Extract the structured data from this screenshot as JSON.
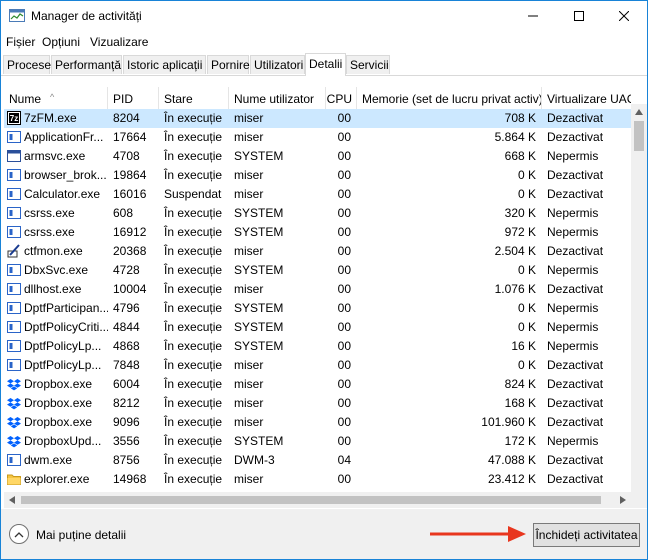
{
  "window": {
    "title": "Manager de activități"
  },
  "menu": [
    "Fișier",
    "Opțiuni",
    "Vizualizare"
  ],
  "tabs": [
    {
      "label": "Procese",
      "active": false
    },
    {
      "label": "Performanță",
      "active": false
    },
    {
      "label": "Istoric aplicații",
      "active": false
    },
    {
      "label": "Pornire",
      "active": false
    },
    {
      "label": "Utilizatori",
      "active": false
    },
    {
      "label": "Detalii",
      "active": true
    },
    {
      "label": "Servicii",
      "active": false
    }
  ],
  "table": {
    "columns": [
      "Nume",
      "PID",
      "Stare",
      "Nume utilizator",
      "CPU",
      "Memorie (set de lucru privat activ)",
      "Virtualizare UAC"
    ],
    "sort_column": "Nume",
    "rows": [
      {
        "icon": "7zfm-icon",
        "name": "7zFM.exe",
        "pid": "8204",
        "status": "În execuție",
        "user": "miser",
        "cpu": "00",
        "memory": "708 K",
        "uac": "Dezactivat",
        "selected": true
      },
      {
        "icon": "app-window-icon",
        "name": "ApplicationFr...",
        "pid": "17664",
        "status": "În execuție",
        "user": "miser",
        "cpu": "00",
        "memory": "5.864 K",
        "uac": "Dezactivat"
      },
      {
        "icon": "window-icon",
        "name": "armsvc.exe",
        "pid": "4708",
        "status": "În execuție",
        "user": "SYSTEM",
        "cpu": "00",
        "memory": "668 K",
        "uac": "Nepermis"
      },
      {
        "icon": "app-window-icon",
        "name": "browser_brok...",
        "pid": "19864",
        "status": "În execuție",
        "user": "miser",
        "cpu": "00",
        "memory": "0 K",
        "uac": "Dezactivat"
      },
      {
        "icon": "app-window-icon",
        "name": "Calculator.exe",
        "pid": "16016",
        "status": "Suspendat",
        "user": "miser",
        "cpu": "00",
        "memory": "0 K",
        "uac": "Dezactivat"
      },
      {
        "icon": "app-window-icon",
        "name": "csrss.exe",
        "pid": "608",
        "status": "În execuție",
        "user": "SYSTEM",
        "cpu": "00",
        "memory": "320 K",
        "uac": "Nepermis"
      },
      {
        "icon": "app-window-icon",
        "name": "csrss.exe",
        "pid": "16912",
        "status": "În execuție",
        "user": "SYSTEM",
        "cpu": "00",
        "memory": "972 K",
        "uac": "Nepermis"
      },
      {
        "icon": "ctfmon-icon",
        "name": "ctfmon.exe",
        "pid": "20368",
        "status": "În execuție",
        "user": "miser",
        "cpu": "00",
        "memory": "2.504 K",
        "uac": "Dezactivat"
      },
      {
        "icon": "app-window-icon",
        "name": "DbxSvc.exe",
        "pid": "4728",
        "status": "În execuție",
        "user": "SYSTEM",
        "cpu": "00",
        "memory": "0 K",
        "uac": "Nepermis"
      },
      {
        "icon": "app-window-icon",
        "name": "dllhost.exe",
        "pid": "10004",
        "status": "În execuție",
        "user": "miser",
        "cpu": "00",
        "memory": "1.076 K",
        "uac": "Dezactivat"
      },
      {
        "icon": "app-window-icon",
        "name": "DptfParticipan...",
        "pid": "4796",
        "status": "În execuție",
        "user": "SYSTEM",
        "cpu": "00",
        "memory": "0 K",
        "uac": "Nepermis"
      },
      {
        "icon": "app-window-icon",
        "name": "DptfPolicyCriti...",
        "pid": "4844",
        "status": "În execuție",
        "user": "SYSTEM",
        "cpu": "00",
        "memory": "0 K",
        "uac": "Nepermis"
      },
      {
        "icon": "app-window-icon",
        "name": "DptfPolicyLp...",
        "pid": "4868",
        "status": "În execuție",
        "user": "SYSTEM",
        "cpu": "00",
        "memory": "16 K",
        "uac": "Nepermis"
      },
      {
        "icon": "app-window-icon",
        "name": "DptfPolicyLp...",
        "pid": "7848",
        "status": "În execuție",
        "user": "miser",
        "cpu": "00",
        "memory": "0 K",
        "uac": "Dezactivat"
      },
      {
        "icon": "dropbox-icon",
        "name": "Dropbox.exe",
        "pid": "6004",
        "status": "În execuție",
        "user": "miser",
        "cpu": "00",
        "memory": "824 K",
        "uac": "Dezactivat"
      },
      {
        "icon": "dropbox-icon",
        "name": "Dropbox.exe",
        "pid": "8212",
        "status": "În execuție",
        "user": "miser",
        "cpu": "00",
        "memory": "168 K",
        "uac": "Dezactivat"
      },
      {
        "icon": "dropbox-icon",
        "name": "Dropbox.exe",
        "pid": "9096",
        "status": "În execuție",
        "user": "miser",
        "cpu": "00",
        "memory": "101.960 K",
        "uac": "Dezactivat"
      },
      {
        "icon": "dropbox-icon",
        "name": "DropboxUpd...",
        "pid": "3556",
        "status": "În execuție",
        "user": "SYSTEM",
        "cpu": "00",
        "memory": "172 K",
        "uac": "Nepermis"
      },
      {
        "icon": "app-window-icon",
        "name": "dwm.exe",
        "pid": "8756",
        "status": "În execuție",
        "user": "DWM-3",
        "cpu": "04",
        "memory": "47.088 K",
        "uac": "Dezactivat"
      },
      {
        "icon": "folder-icon",
        "name": "explorer.exe",
        "pid": "14968",
        "status": "În execuție",
        "user": "miser",
        "cpu": "00",
        "memory": "23.412 K",
        "uac": "Dezactivat"
      }
    ]
  },
  "footer": {
    "fewer_details": "Mai puține detalii",
    "end_task": "Închideți activitatea"
  },
  "colors": {
    "selection": "#cce8ff",
    "accent_border": "#1883d7",
    "arrow": "#e8361e",
    "dropbox": "#0061fe"
  }
}
